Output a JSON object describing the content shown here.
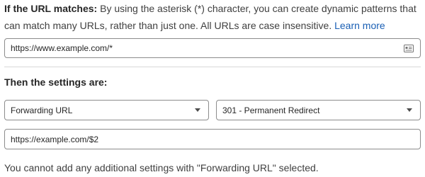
{
  "intro": {
    "label": "If the URL matches:",
    "text": " By using the asterisk (*) character, you can create dynamic patterns that can match many URLs, rather than just one. All URLs are case insensitive. ",
    "link": "Learn more"
  },
  "url_match": {
    "value": "https://www.example.com/*",
    "icon": "contact-card-icon"
  },
  "settings": {
    "title": "Then the settings are:",
    "setting_select": {
      "value": "Forwarding URL",
      "icon": "chevron-down-icon"
    },
    "status_select": {
      "value": "301 - Permanent Redirect",
      "icon": "chevron-down-icon"
    },
    "destination": {
      "value": "https://example.com/$2"
    }
  },
  "note": "You cannot add any additional settings with \"Forwarding URL\" selected."
}
